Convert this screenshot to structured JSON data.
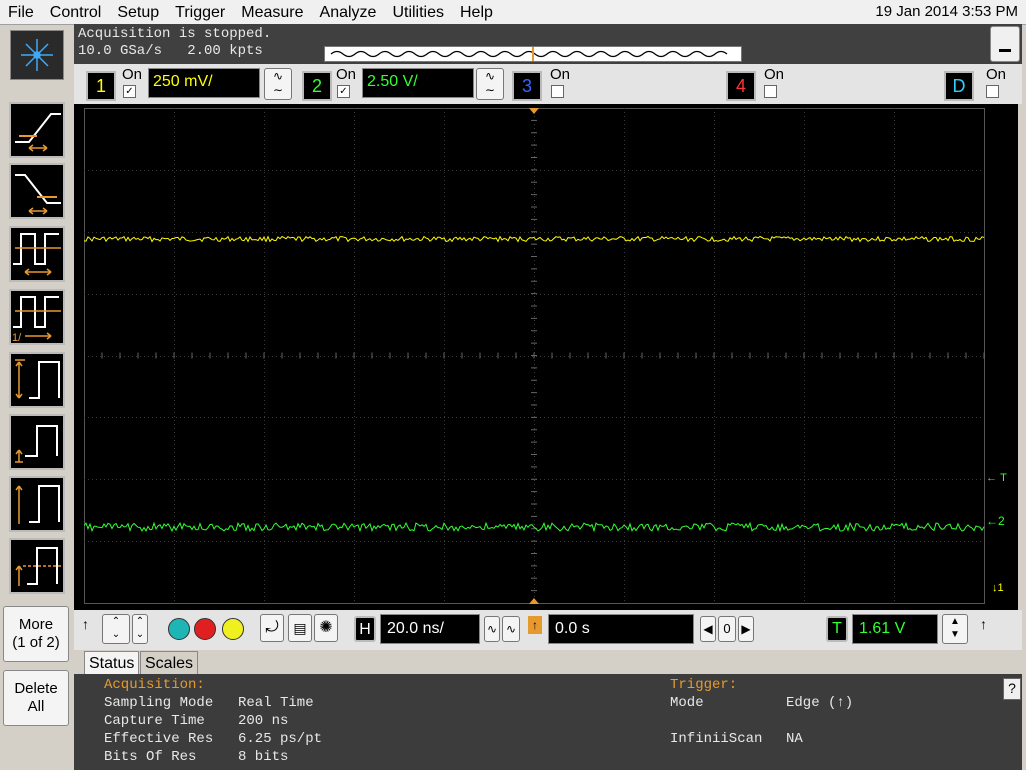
{
  "menu": [
    "File",
    "Control",
    "Setup",
    "Trigger",
    "Measure",
    "Analyze",
    "Utilities",
    "Help"
  ],
  "datetime": "19 Jan 2014  3:53 PM",
  "acquisition": {
    "status_line": "Acquisition is stopped.",
    "rate_line": "10.0 GSa/s   2.00 kpts"
  },
  "channels": {
    "ch1": {
      "num": "1",
      "on": "On",
      "scale": "250 mV/",
      "checked": "✓",
      "color": "#ffff00"
    },
    "ch2": {
      "num": "2",
      "on": "On",
      "scale": "2.50 V/",
      "checked": "✓",
      "color": "#33ff33"
    },
    "ch3": {
      "num": "3",
      "on": "On",
      "checked": "",
      "color": "#3366ff"
    },
    "ch4": {
      "num": "4",
      "on": "On",
      "checked": "",
      "color": "#ff3333"
    },
    "digital": {
      "num": "D",
      "on": "On",
      "checked": "",
      "color": "#33ccff"
    }
  },
  "side": {
    "more_label": "More",
    "more_page": "(1 of 2)",
    "delete_label": "Delete",
    "delete_all": "All"
  },
  "waveform_markers": {
    "trigger": "T",
    "ch2": "2",
    "ch1": "1"
  },
  "horizontal": {
    "label": "H",
    "scale": "20.0 ns/",
    "position": "0.0 s",
    "ref": "0"
  },
  "trigger": {
    "label": "T",
    "level": "1.61 V"
  },
  "tabs": [
    "Status",
    "Scales"
  ],
  "status": {
    "acq_header": "Acquisition:",
    "rows": [
      {
        "k": "Sampling Mode",
        "v": "Real Time"
      },
      {
        "k": "Capture Time",
        "v": "200 ns"
      },
      {
        "k": "Effective Res",
        "v": "6.25 ps/pt"
      },
      {
        "k": "Bits Of Res",
        "v": "8 bits"
      }
    ],
    "trig_header": "Trigger:",
    "trig_rows": [
      {
        "k": "Mode",
        "v": "Edge (↑)"
      },
      {
        "k": "InfiniiScan",
        "v": "NA"
      }
    ]
  },
  "help": "?"
}
